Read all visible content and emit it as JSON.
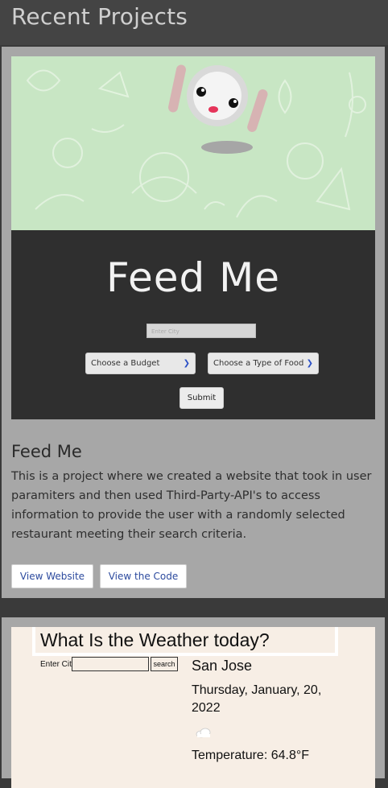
{
  "header": {
    "title": "Recent Projects"
  },
  "projects": [
    {
      "screenshot": {
        "app_title": "Feed Me",
        "city_placeholder": "Enter City",
        "budget_select": "Choose a Budget",
        "food_select": "Choose a Type of Food",
        "submit_label": "Submit"
      },
      "title": "Feed Me",
      "description": "This is a project where we created a website that took in user paramiters and then used Third-Party-API's to access information to provide the user with a randomly selected restaurant meeting their search criteria.",
      "view_website_label": "View Website",
      "view_code_label": "View the Code"
    },
    {
      "screenshot": {
        "app_title": "What Is the Weather today?",
        "city_label": "Enter City",
        "search_label": "search",
        "city": "San Jose",
        "date": "Thursday, January, 20, 2022",
        "weather_icon": "cloud-icon",
        "temperature": "Temperature: 64.8°F"
      }
    }
  ],
  "colors": {
    "page_bg": "#3a3a3a",
    "header_bg": "#444444",
    "card_bg": "#a7a7a7",
    "link_blue": "#2c4a9e",
    "banner_green": "#c8e6c4",
    "dark_panel": "#2f2f2f"
  }
}
